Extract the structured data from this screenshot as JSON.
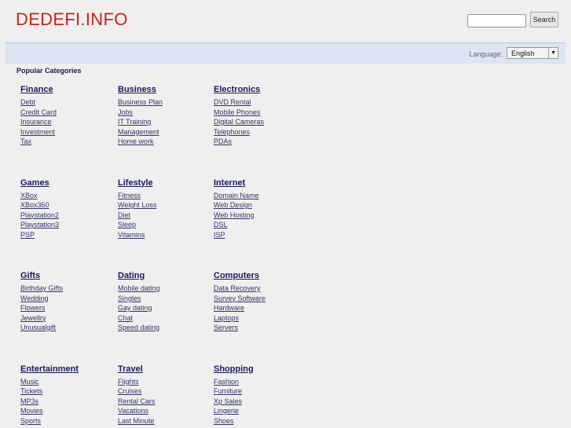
{
  "header": {
    "logo": "DEDEFI.INFO",
    "search_value": "",
    "search_button": "Search"
  },
  "language": {
    "label": "Language:",
    "selected": "English"
  },
  "popular_title": "Popular Categories",
  "categories": [
    {
      "title": "Finance",
      "links": [
        "Debt",
        "Credit Card",
        "Insurance",
        "Investment",
        "Tax"
      ]
    },
    {
      "title": "Business",
      "links": [
        "Business Plan",
        "Jobs",
        "IT Training",
        "Management",
        "Home work"
      ]
    },
    {
      "title": "Electronics",
      "links": [
        "DVD Rental",
        "Mobile Phones",
        "Digital Cameras",
        "Telephones",
        "PDAs"
      ]
    },
    {
      "title": "Games",
      "links": [
        "XBox",
        "XBox360",
        "Playstation2",
        "Playstation3",
        "PSP"
      ]
    },
    {
      "title": "Lifestyle",
      "links": [
        "Fitness",
        "Weight Loss",
        "Diet",
        "Sleep",
        "Vitamins"
      ]
    },
    {
      "title": "Internet",
      "links": [
        "Domain Name",
        "Web Design",
        "Web Hosting",
        "DSL",
        "ISP"
      ]
    },
    {
      "title": "Gifts",
      "links": [
        "Birthday Gifts",
        "Wedding",
        "Flowers",
        "Jewellry",
        "Unusualgift"
      ]
    },
    {
      "title": "Dating",
      "links": [
        "Mobile dating",
        "Singles",
        "Gay dating",
        "Chat",
        "Speed dating"
      ]
    },
    {
      "title": "Computers",
      "links": [
        "Data Recovery",
        "Survey Software",
        "Hardware",
        "Laptops",
        "Servers"
      ]
    },
    {
      "title": "Entertainment",
      "links": [
        "Music",
        "Tickets",
        "MP3s",
        "Movies",
        "Sports"
      ]
    },
    {
      "title": "Travel",
      "links": [
        "Flights",
        "Cruises",
        "Rental Cars",
        "Vacations",
        "Last Minute"
      ]
    },
    {
      "title": "Shopping",
      "links": [
        "Fashion",
        "Furniture",
        "Xp Sales",
        "Lingerie",
        "Shoes"
      ]
    }
  ]
}
